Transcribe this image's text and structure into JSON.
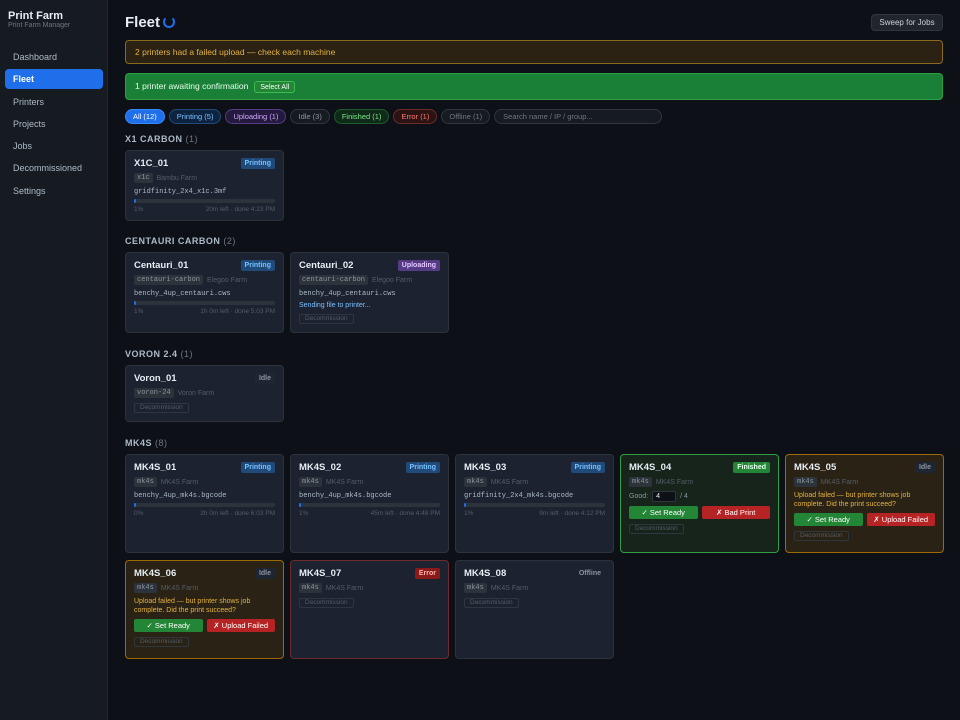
{
  "app": {
    "title": "Print Farm",
    "subtitle": "Print Farm Manager"
  },
  "nav": [
    {
      "label": "Dashboard"
    },
    {
      "label": "Fleet"
    },
    {
      "label": "Printers"
    },
    {
      "label": "Projects"
    },
    {
      "label": "Jobs"
    },
    {
      "label": "Decommissioned"
    },
    {
      "label": "Settings"
    }
  ],
  "header": {
    "title": "Fleet",
    "sweep_label": "Sweep for Jobs"
  },
  "alerts": {
    "warning": "2 printers had a failed upload — check each machine",
    "confirm": "1 printer awaiting confirmation",
    "select_all": "Select All"
  },
  "filters": {
    "all": "All (12)",
    "printing": "Printing (5)",
    "uploading": "Uploading (1)",
    "idle": "Idle (3)",
    "finished": "Finished (1)",
    "error": "Error (1)",
    "offline": "Offline (1)",
    "search_placeholder": "Search name / IP / group..."
  },
  "groups": {
    "x1c": {
      "name": "X1 CARBON",
      "count": "(1)"
    },
    "cc": {
      "name": "CENTAURI CARBON",
      "count": "(2)"
    },
    "voron": {
      "name": "VORON 2.4",
      "count": "(1)"
    },
    "mk4s": {
      "name": "MK4S",
      "count": "(8)"
    }
  },
  "common": {
    "decommission": "Decommission",
    "set_ready": "✓ Set Ready",
    "bad_print": "✗ Bad Print",
    "upload_failed": "✗ Upload Failed",
    "upload_failed_msg": "Upload failed — but printer shows job complete. Did the print succeed?",
    "sending": "Sending file to printer...",
    "good_label": "Good:",
    "good_of": "/ 4"
  },
  "statuses": {
    "printing": "Printing",
    "uploading": "Uploading",
    "idle": "Idle",
    "finished": "Finished",
    "error": "Error",
    "offline": "Offline"
  },
  "printers": {
    "x1c_01": {
      "name": "X1C_01",
      "model": "x1c",
      "farm": "Bambu Farm",
      "file": "gridfinity_2x4_x1c.3mf",
      "progress": 1,
      "pct": "1%",
      "eta": "20m left · done 4:23 PM"
    },
    "cc_01": {
      "name": "Centauri_01",
      "model": "centauri-carbon",
      "farm": "Elegoo Farm",
      "file": "benchy_4up_centauri.cws",
      "progress": 1,
      "pct": "1%",
      "eta": "1h 0m left · done 5:03 PM"
    },
    "cc_02": {
      "name": "Centauri_02",
      "model": "centauri-carbon",
      "farm": "Elegoo Farm",
      "file": "benchy_4up_centauri.cws"
    },
    "voron_01": {
      "name": "Voron_01",
      "model": "voron-24",
      "farm": "Voron Farm"
    },
    "mk4s_01": {
      "name": "MK4S_01",
      "model": "mk4s",
      "farm": "MK4S Farm",
      "file": "benchy_4up_mk4s.bgcode",
      "progress": 1,
      "pct": "0%",
      "eta": "2h 0m left · done 6:03 PM"
    },
    "mk4s_02": {
      "name": "MK4S_02",
      "model": "mk4s",
      "farm": "MK4S Farm",
      "file": "benchy_4up_mk4s.bgcode",
      "progress": 1,
      "pct": "1%",
      "eta": "45m left · done 4:48 PM"
    },
    "mk4s_03": {
      "name": "MK4S_03",
      "model": "mk4s",
      "farm": "MK4S Farm",
      "file": "gridfinity_2x4_mk4s.bgcode",
      "progress": 1,
      "pct": "1%",
      "eta": "9m left · done 4:12 PM"
    },
    "mk4s_04": {
      "name": "MK4S_04",
      "model": "mk4s",
      "farm": "MK4S Farm",
      "good": "4"
    },
    "mk4s_05": {
      "name": "MK4S_05",
      "model": "mk4s",
      "farm": "MK4S Farm"
    },
    "mk4s_06": {
      "name": "MK4S_06",
      "model": "mk4s",
      "farm": "MK4S Farm"
    },
    "mk4s_07": {
      "name": "MK4S_07",
      "model": "mk4s",
      "farm": "MK4S Farm"
    },
    "mk4s_08": {
      "name": "MK4S_08",
      "model": "mk4s",
      "farm": "MK4S Farm"
    }
  },
  "colors": {
    "accent": "#1f6feb",
    "success": "#238636",
    "danger": "#b62324",
    "warning": "#e3b341"
  }
}
